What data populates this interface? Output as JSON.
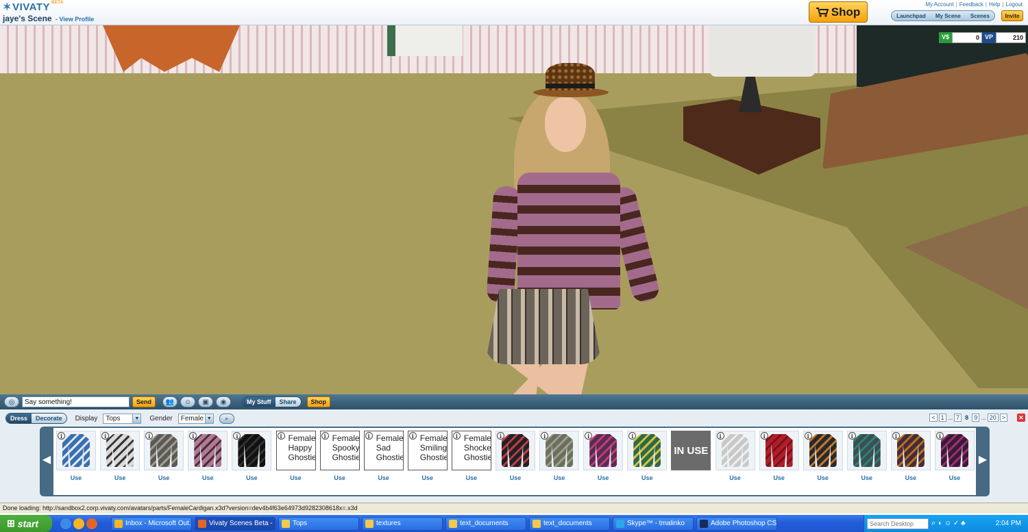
{
  "header": {
    "logo": "VIVATY",
    "logo_badge": "BETA",
    "scene_title": "jaye's Scene",
    "view_profile": "- View Profile",
    "links": [
      "My Account",
      "Feedback",
      "Help",
      "Logout"
    ],
    "shop": "Shop",
    "nav": [
      "Launchpad",
      "My Scene",
      "Scenes"
    ],
    "invite": "Invite"
  },
  "currency": {
    "vs_label": "V$",
    "vs_value": "0",
    "vp_label": "VP",
    "vp_value": "210"
  },
  "chat": {
    "input_value": "Say something!",
    "send": "Send",
    "my_stuff": "My Stuff",
    "share": "Share",
    "shop": "Shop"
  },
  "inventory": {
    "mode_dress": "Dress",
    "mode_decorate": "Decorate",
    "display_label": "Display",
    "display_value": "Tops",
    "gender_label": "Gender",
    "gender_value": "Female",
    "pager": {
      "prev": "<",
      "pages": [
        "1",
        "...",
        "7",
        "8",
        "9",
        "...",
        "20"
      ],
      "current": "8",
      "next": ">"
    },
    "use_label": "Use",
    "in_use_label": "IN USE",
    "items": [
      {
        "kind": "shirt",
        "color": "#3a6fb0",
        "accent": "#dfe9f5"
      },
      {
        "kind": "shirt",
        "color": "#d9d9d9",
        "accent": "#333333"
      },
      {
        "kind": "shirt",
        "color": "#5a5a5a",
        "accent": "#a59f8a"
      },
      {
        "kind": "shirt",
        "color": "#b07a95",
        "accent": "#4a2b36"
      },
      {
        "kind": "shirt",
        "color": "#111111",
        "accent": "#333333"
      },
      {
        "kind": "text",
        "lines": [
          "Female",
          "Happy",
          "Ghostie"
        ]
      },
      {
        "kind": "text",
        "lines": [
          "Female",
          "Spooky",
          "Ghostie"
        ]
      },
      {
        "kind": "text",
        "lines": [
          "Female",
          "Sad",
          "Ghostie"
        ]
      },
      {
        "kind": "text",
        "lines": [
          "Female",
          "Smiling",
          "Ghostie"
        ]
      },
      {
        "kind": "text",
        "lines": [
          "Female",
          "Shocked",
          "Ghostie"
        ]
      },
      {
        "kind": "shirt",
        "color": "#222222",
        "accent": "#c23a4a"
      },
      {
        "kind": "shirt",
        "color": "#6d6e5e",
        "accent": "#9aa18a"
      },
      {
        "kind": "shirt",
        "color": "#5a2a5a",
        "accent": "#c2406a"
      },
      {
        "kind": "shirt",
        "color": "#2f6a4a",
        "accent": "#d9c23a"
      },
      {
        "kind": "inuse"
      },
      {
        "kind": "shirt",
        "color": "#c8c8c8",
        "accent": "#eeeeee"
      },
      {
        "kind": "shirt",
        "color": "#b01e2a",
        "accent": "#7a1018"
      },
      {
        "kind": "shirt",
        "color": "#2a2a2a",
        "accent": "#c5772a"
      },
      {
        "kind": "shirt",
        "color": "#3a5050",
        "accent": "#2f7f7a"
      },
      {
        "kind": "shirt",
        "color": "#4a2a3a",
        "accent": "#b0781a"
      },
      {
        "kind": "shirt",
        "color": "#3a1a3a",
        "accent": "#a0306a"
      }
    ]
  },
  "status_bar": "Done loading: http://sandbox2.corp.vivaty.com/avatars/parts/FemaleCardigan.x3d?version=dev4b4f63e64973d9282308618x=.x3d",
  "taskbar": {
    "start": "start",
    "tasks": [
      "Inbox - Microsoft Out...",
      "Vivaty Scenes Beta - ...",
      "Tops",
      "textures",
      "text_documents",
      "text_documents",
      "Skype™ - tmalinko",
      "Adobe Photoshop CS..."
    ],
    "search_placeholder": "Search Desktop",
    "clock": "2:04 PM"
  }
}
